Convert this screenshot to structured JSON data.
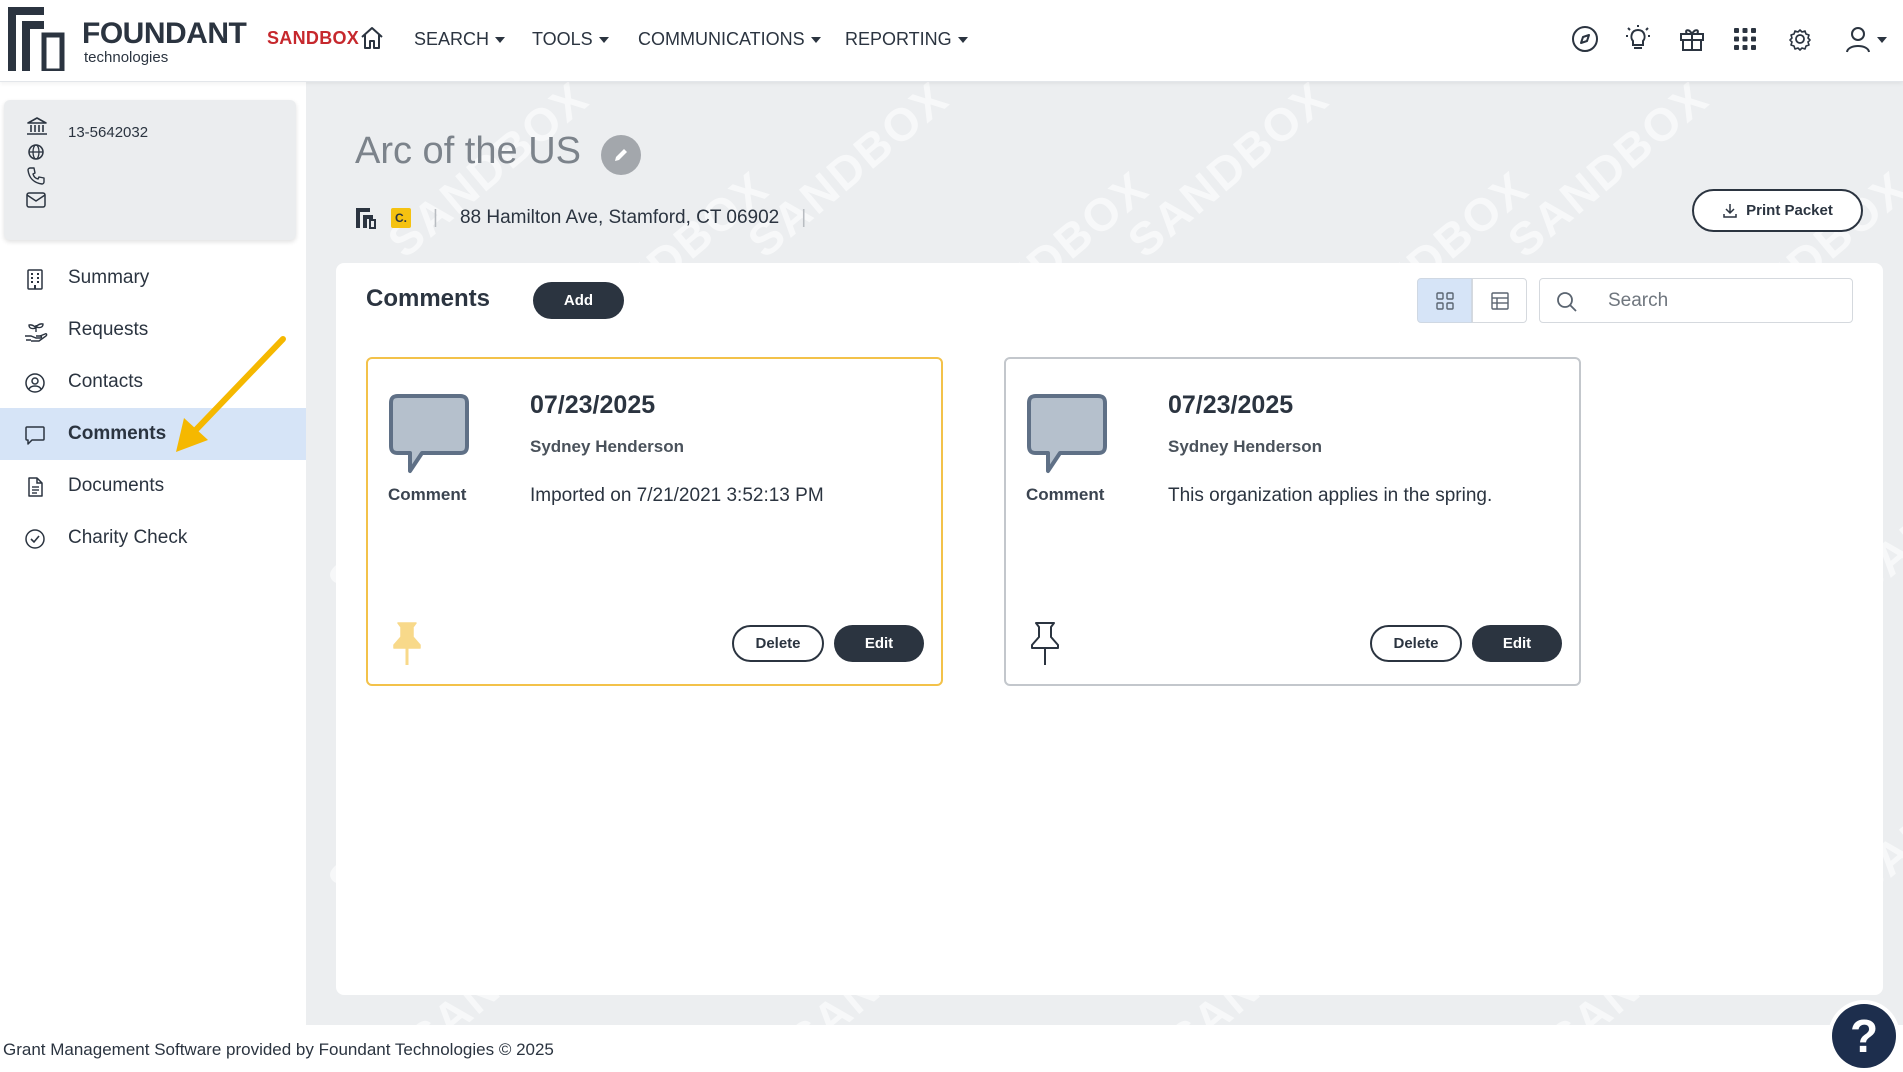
{
  "topnav": {
    "logo_name": "FOUNDANT",
    "logo_sub": "technologies",
    "env": "SANDBOX",
    "menu": [
      "SEARCH",
      "TOOLS",
      "COMMUNICATIONS",
      "REPORTING"
    ],
    "icons": [
      "compass-icon",
      "lightbulb-icon",
      "gift-icon",
      "apps-grid-icon",
      "gear-icon",
      "user-icon"
    ]
  },
  "org": {
    "ein": "13-5642032",
    "name": "Arc of the US",
    "badge": "C.",
    "address": "88 Hamilton Ave, Stamford, CT 06902"
  },
  "sidebar": {
    "items": [
      {
        "label": "Summary",
        "icon": "building-icon"
      },
      {
        "label": "Requests",
        "icon": "hand-plant-icon"
      },
      {
        "label": "Contacts",
        "icon": "user-circle-icon"
      },
      {
        "label": "Comments",
        "icon": "comment-icon",
        "active": true
      },
      {
        "label": "Documents",
        "icon": "document-icon"
      },
      {
        "label": "Charity Check",
        "icon": "check-circle-icon"
      }
    ]
  },
  "actions": {
    "print_label": "Print Packet"
  },
  "panel": {
    "title": "Comments",
    "add_label": "Add",
    "search_placeholder": "Search"
  },
  "comments": [
    {
      "type": "Comment",
      "date": "07/23/2025",
      "author": "Sydney Henderson",
      "text": "Imported on 7/21/2021 3:52:13 PM",
      "pinned": true,
      "delete_label": "Delete",
      "edit_label": "Edit"
    },
    {
      "type": "Comment",
      "date": "07/23/2025",
      "author": "Sydney Henderson",
      "text": "This organization applies in the spring.",
      "pinned": false,
      "delete_label": "Delete",
      "edit_label": "Edit"
    }
  ],
  "watermark": "SANDBOX",
  "footer": {
    "text": "Grant Management Software provided by Foundant Technologies © 2025"
  },
  "help": {
    "label": "?"
  },
  "colors": {
    "primary": "#2b3440",
    "sandbox_red": "#c6282d",
    "active_bg": "#d6e4f7",
    "pinned_border": "#f3c24a",
    "arrow": "#f5b800"
  }
}
